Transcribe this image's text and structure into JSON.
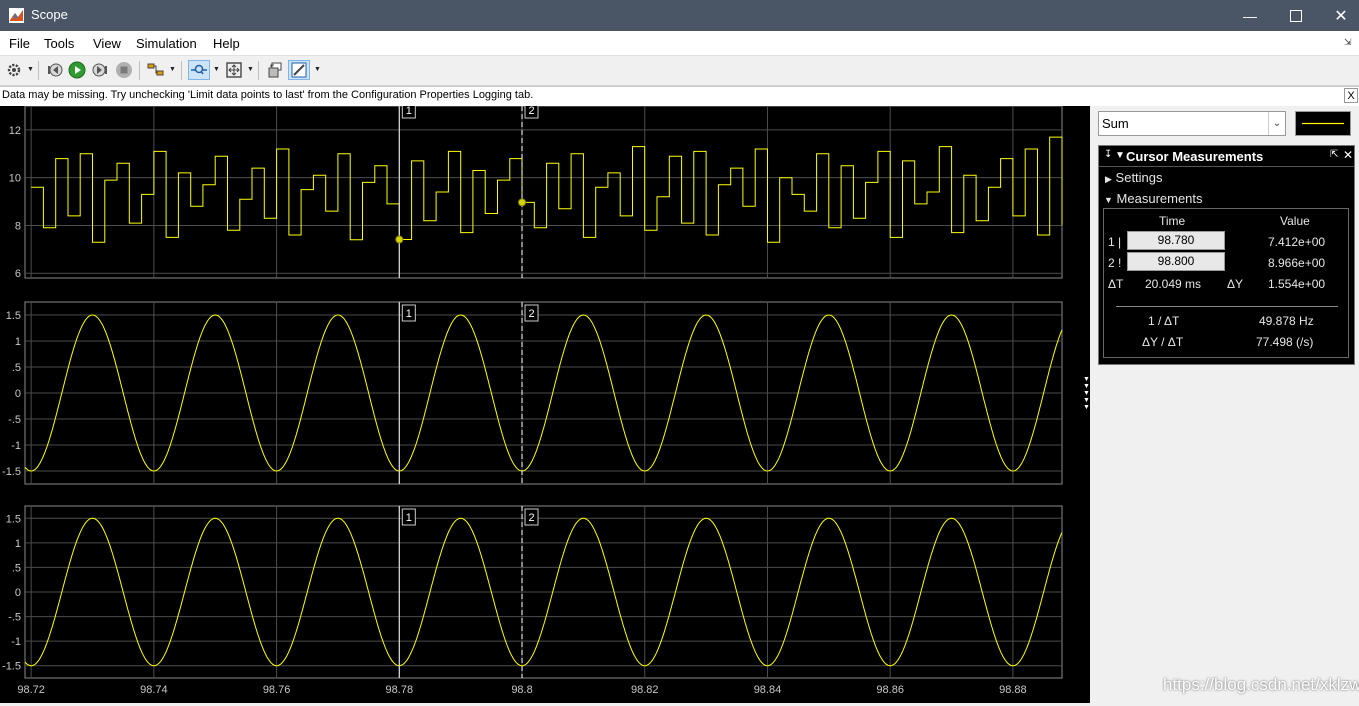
{
  "window": {
    "title": "Scope",
    "buttons": [
      "minimize",
      "maximize",
      "close"
    ]
  },
  "menu": {
    "items": [
      "File",
      "Tools",
      "View",
      "Simulation",
      "Help"
    ]
  },
  "toolbar": {
    "icons": [
      "gear-icon",
      "step-back-icon",
      "run-icon",
      "step-forward-icon",
      "stop-icon",
      "highlight-icon",
      "zoom-icon",
      "autoscale-icon",
      "restore-layout-icon",
      "measurements-icon"
    ]
  },
  "infobar": {
    "message": "Data may be missing.  Try unchecking 'Limit data points to last' from the Configuration Properties Logging tab.",
    "close_label": "X"
  },
  "signal_select": {
    "value": "Sum",
    "line_color": "#ffff00"
  },
  "cursor_measurements": {
    "title": "Cursor Measurements",
    "settings_label": "Settings",
    "measurements_label": "Measurements",
    "time_header": "Time",
    "value_header": "Value",
    "row1_label": "1 |",
    "row1_time": "98.780",
    "row1_value": "7.412e+00",
    "row2_label": "2 !",
    "row2_time": "98.800",
    "row2_value": "8.966e+00",
    "dt_label": "ΔT",
    "dt_value": "20.049 ms",
    "dy_label": "ΔY",
    "dy_value": "1.554e+00",
    "inv_dt_label": "1 / ΔT",
    "inv_dt_value": "49.878 Hz",
    "dy_dt_label": "ΔY / ΔT",
    "dy_dt_value": "77.498 (/s)"
  },
  "cursors": {
    "cursor1_label": "1",
    "cursor2_label": "2",
    "cursor1_time": 98.78,
    "cursor2_time": 98.8
  },
  "x_axis": {
    "ticks": [
      "98.72",
      "98.74",
      "98.76",
      "98.78",
      "98.8",
      "98.82",
      "98.84",
      "98.86",
      "98.88"
    ]
  },
  "watermark": "https://blog.csdn.net/xklzw",
  "colors": {
    "trace": "#ffff00",
    "background": "#000000",
    "grid": "#4d4d4d",
    "titlebar": "#4a5566"
  },
  "chart_data": [
    {
      "type": "line",
      "series_description": "noisy signal",
      "x_range": [
        98.719,
        98.888
      ],
      "ylim": [
        5.8,
        13
      ],
      "yticks": [
        "12",
        "10",
        "8",
        "6"
      ],
      "x": [
        98.72,
        98.722,
        98.724,
        98.726,
        98.728,
        98.73,
        98.732,
        98.734,
        98.736,
        98.738,
        98.74,
        98.742,
        98.744,
        98.746,
        98.748,
        98.75,
        98.752,
        98.754,
        98.756,
        98.758,
        98.76,
        98.762,
        98.764,
        98.766,
        98.768,
        98.77,
        98.772,
        98.774,
        98.776,
        98.778,
        98.78,
        98.782,
        98.784,
        98.786,
        98.788,
        98.79,
        98.792,
        98.794,
        98.796,
        98.798,
        98.8,
        98.802,
        98.804,
        98.806,
        98.808,
        98.81,
        98.812,
        98.814,
        98.816,
        98.818,
        98.82,
        98.822,
        98.824,
        98.826,
        98.828,
        98.83,
        98.832,
        98.834,
        98.836,
        98.838,
        98.84,
        98.842,
        98.844,
        98.846,
        98.848,
        98.85,
        98.852,
        98.854,
        98.856,
        98.858,
        98.86,
        98.862,
        98.864,
        98.866,
        98.868,
        98.87,
        98.872,
        98.874,
        98.876,
        98.878,
        98.88,
        98.882,
        98.884,
        98.886,
        98.888
      ],
      "y": [
        9.6,
        7.9,
        10.8,
        8.4,
        11.0,
        7.3,
        9.9,
        10.6,
        8.1,
        9.3,
        11.1,
        7.5,
        10.2,
        8.8,
        9.7,
        10.9,
        7.8,
        9.1,
        10.4,
        8.3,
        11.2,
        7.6,
        9.5,
        10.1,
        8.6,
        11.0,
        7.4,
        9.8,
        10.5,
        8.9,
        7.412,
        10.7,
        8.2,
        9.4,
        11.1,
        7.7,
        10.3,
        8.5,
        9.9,
        10.8,
        8.966,
        7.9,
        10.6,
        8.7,
        11.0,
        7.5,
        9.6,
        10.2,
        8.4,
        11.3,
        7.8,
        9.2,
        10.9,
        8.1,
        11.1,
        7.6,
        9.7,
        10.4,
        8.8,
        11.2,
        7.3,
        10.0,
        9.3,
        8.6,
        11.0,
        7.9,
        10.5,
        8.3,
        9.8,
        11.1,
        7.5,
        10.7,
        8.9,
        9.4,
        11.3,
        7.7,
        10.1,
        8.2,
        9.6,
        10.8,
        8.4,
        11.2,
        7.6,
        11.7,
        8.0
      ]
    },
    {
      "type": "line",
      "series_description": "sine wave, 50 Hz",
      "x_range": [
        98.719,
        98.888
      ],
      "ylim": [
        -1.75,
        1.75
      ],
      "yticks": [
        "1.5",
        "1",
        ".5",
        "0",
        "-.5",
        "-1",
        "-1.5"
      ],
      "amplitude": 1.5,
      "period": 0.02,
      "peak_times": [
        98.73,
        98.75,
        98.77,
        98.79,
        98.81,
        98.83,
        98.85,
        98.87
      ]
    },
    {
      "type": "line",
      "series_description": "sine wave, 50 Hz",
      "x_range": [
        98.719,
        98.888
      ],
      "ylim": [
        -1.75,
        1.75
      ],
      "yticks": [
        "1.5",
        "1",
        ".5",
        "0",
        "-.5",
        "-1",
        "-1.5"
      ],
      "amplitude": 1.5,
      "period": 0.02,
      "peak_times": [
        98.73,
        98.75,
        98.77,
        98.79,
        98.81,
        98.83,
        98.85,
        98.87
      ]
    }
  ]
}
